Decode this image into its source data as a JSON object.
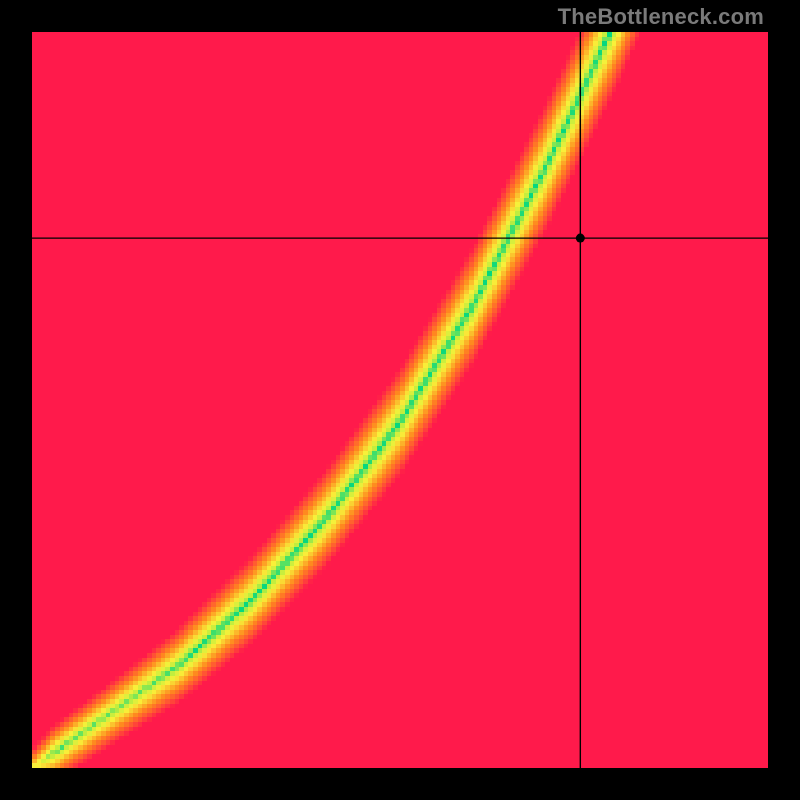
{
  "watermark": "TheBottleneck.com",
  "chart_data": {
    "type": "heatmap",
    "title": "",
    "xlabel": "",
    "ylabel": "",
    "xlim": [
      0,
      1
    ],
    "ylim": [
      0,
      1
    ],
    "ideal_ridge": {
      "description": "green optimal-balance ridge; fx maps x in [0,1] to ideal y in [0,1]",
      "control_points_x": [
        0.0,
        0.1,
        0.2,
        0.3,
        0.4,
        0.5,
        0.6,
        0.7,
        0.8,
        0.9,
        1.0
      ],
      "control_points_y": [
        0.0,
        0.07,
        0.14,
        0.23,
        0.34,
        0.47,
        0.63,
        0.82,
        1.03,
        1.27,
        1.55
      ],
      "half_width": 0.045
    },
    "crosshair": {
      "x": 0.745,
      "y": 0.72
    },
    "grid_resolution": 160,
    "color_stops": {
      "red": "#ff1a4b",
      "orange": "#ff8a1f",
      "yellow": "#f9f13a",
      "yellowgreen": "#c1ee3f",
      "green": "#00d781"
    }
  }
}
